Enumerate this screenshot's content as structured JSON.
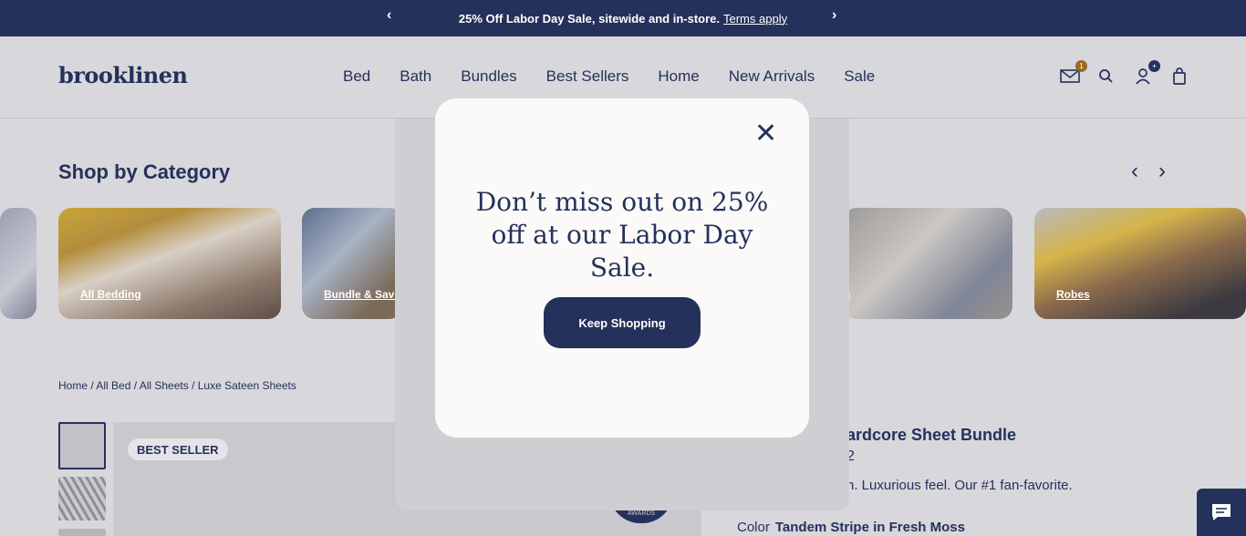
{
  "announcement": {
    "text": "25% Off Labor Day Sale, sitewide and in-store.",
    "terms": "Terms apply"
  },
  "logo": "brooklinen",
  "nav": [
    "Bed",
    "Bath",
    "Bundles",
    "Best Sellers",
    "Home",
    "New Arrivals",
    "Sale"
  ],
  "header_icons": {
    "mail_badge": "1",
    "account_badge": "+"
  },
  "shop_by_category": {
    "title": "Shop by Category",
    "cards": [
      {
        "label": ""
      },
      {
        "label": "All Bedding"
      },
      {
        "label": "Bundle & Save"
      },
      {
        "label": "n"
      },
      {
        "label": "Robes"
      }
    ]
  },
  "breadcrumb": "Home / All Bed / All Sheets / Luxe Sateen Sheets",
  "product": {
    "badge": "BEST SELLER",
    "title_partial": "ardcore Sheet Bundle",
    "rating_partial": "2",
    "desc_partial": "n. Luxurious feel. Our #1 fan-favorite.",
    "color_label": "Color",
    "color_value": "Tandem Stripe in Fresh Moss",
    "award_text": "AWARDS"
  },
  "modal": {
    "heading": "Don’t miss out on 25% off at our Labor Day Sale.",
    "button": "Keep Shopping"
  },
  "colors": {
    "navy": "#24315a",
    "badge_gold": "#9a6c1d",
    "modal_bg": "#fbfaf8",
    "page_bg": "#d8d7dc"
  }
}
